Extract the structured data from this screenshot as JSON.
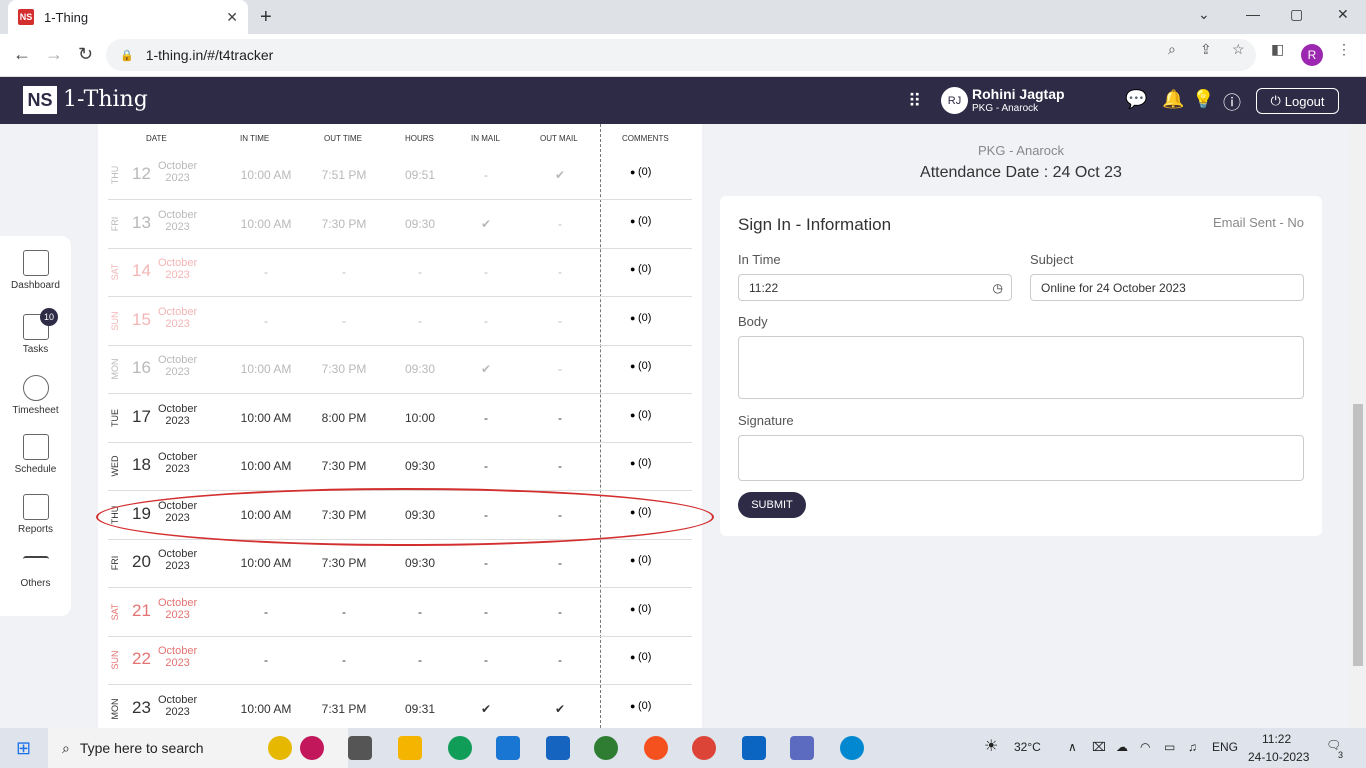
{
  "browser": {
    "tab_title": "1-Thing",
    "favicon": "NS",
    "url": "1-thing.in/#/t4tracker",
    "profile": "R"
  },
  "header": {
    "logo_ns": "NS",
    "logo_text": "1-Thing",
    "avatar": "RJ",
    "user_name": "Rohini Jagtap",
    "user_role": "PKG - Anarock",
    "logout": "Logout"
  },
  "sidenav": {
    "items": [
      {
        "label": "Dashboard"
      },
      {
        "label": "Tasks",
        "badge": "10"
      },
      {
        "label": "Timesheet"
      },
      {
        "label": "Schedule"
      },
      {
        "label": "Reports"
      },
      {
        "label": "Others"
      }
    ]
  },
  "table": {
    "headers": [
      "DATE",
      "IN TIME",
      "OUT TIME",
      "HOURS",
      "IN MAIL",
      "OUT MAIL",
      "COMMENTS"
    ],
    "rows": [
      {
        "dow": "THU",
        "day": "12",
        "month": "October",
        "year": "2023",
        "in": "10:00 AM",
        "out": "7:51 PM",
        "hours": "09:51",
        "inmail": "-",
        "outmail": "✔",
        "comments": "(0)",
        "style": "faded"
      },
      {
        "dow": "FRI",
        "day": "13",
        "month": "October",
        "year": "2023",
        "in": "10:00 AM",
        "out": "7:30 PM",
        "hours": "09:30",
        "inmail": "✔",
        "outmail": "-",
        "comments": "(0)",
        "style": "faded"
      },
      {
        "dow": "SAT",
        "day": "14",
        "month": "October",
        "year": "2023",
        "in": "-",
        "out": "-",
        "hours": "-",
        "inmail": "-",
        "outmail": "-",
        "comments": "(0)",
        "style": "weekend-faded"
      },
      {
        "dow": "SUN",
        "day": "15",
        "month": "October",
        "year": "2023",
        "in": "-",
        "out": "-",
        "hours": "-",
        "inmail": "-",
        "outmail": "-",
        "comments": "(0)",
        "style": "weekend-faded"
      },
      {
        "dow": "MON",
        "day": "16",
        "month": "October",
        "year": "2023",
        "in": "10:00 AM",
        "out": "7:30 PM",
        "hours": "09:30",
        "inmail": "✔",
        "outmail": "-",
        "comments": "(0)",
        "style": "faded"
      },
      {
        "dow": "TUE",
        "day": "17",
        "month": "October",
        "year": "2023",
        "in": "10:00 AM",
        "out": "8:00 PM",
        "hours": "10:00",
        "inmail": "-",
        "outmail": "-",
        "comments": "(0)",
        "style": "normal"
      },
      {
        "dow": "WED",
        "day": "18",
        "month": "October",
        "year": "2023",
        "in": "10:00 AM",
        "out": "7:30 PM",
        "hours": "09:30",
        "inmail": "-",
        "outmail": "-",
        "comments": "(0)",
        "style": "normal"
      },
      {
        "dow": "THU",
        "day": "19",
        "month": "October",
        "year": "2023",
        "in": "10:00 AM",
        "out": "7:30 PM",
        "hours": "09:30",
        "inmail": "-",
        "outmail": "-",
        "comments": "(0)",
        "style": "normal"
      },
      {
        "dow": "FRI",
        "day": "20",
        "month": "October",
        "year": "2023",
        "in": "10:00 AM",
        "out": "7:30 PM",
        "hours": "09:30",
        "inmail": "-",
        "outmail": "-",
        "comments": "(0)",
        "style": "normal"
      },
      {
        "dow": "SAT",
        "day": "21",
        "month": "October",
        "year": "2023",
        "in": "-",
        "out": "-",
        "hours": "-",
        "inmail": "-",
        "outmail": "-",
        "comments": "(0)",
        "style": "weekend"
      },
      {
        "dow": "SUN",
        "day": "22",
        "month": "October",
        "year": "2023",
        "in": "-",
        "out": "-",
        "hours": "-",
        "inmail": "-",
        "outmail": "-",
        "comments": "(0)",
        "style": "weekend"
      },
      {
        "dow": "MON",
        "day": "23",
        "month": "October",
        "year": "2023",
        "in": "10:00 AM",
        "out": "7:31 PM",
        "hours": "09:31",
        "inmail": "✔",
        "outmail": "✔",
        "comments": "(0)",
        "style": "normal"
      }
    ]
  },
  "panel": {
    "pkg": "PKG - Anarock",
    "attendance_date": "Attendance Date : 24 Oct 23",
    "title": "Sign In - Information",
    "email_sent": "Email Sent - No",
    "in_time_label": "In Time",
    "in_time_value": "11:22",
    "subject_label": "Subject",
    "subject_value": "Online for 24 October 2023",
    "body_label": "Body",
    "signature_label": "Signature",
    "submit": "SUBMIT"
  },
  "taskbar": {
    "search_placeholder": "Type here to search",
    "temperature": "32°C",
    "lang": "ENG",
    "time": "11:22",
    "date": "24-10-2023",
    "notif_count": "3"
  }
}
